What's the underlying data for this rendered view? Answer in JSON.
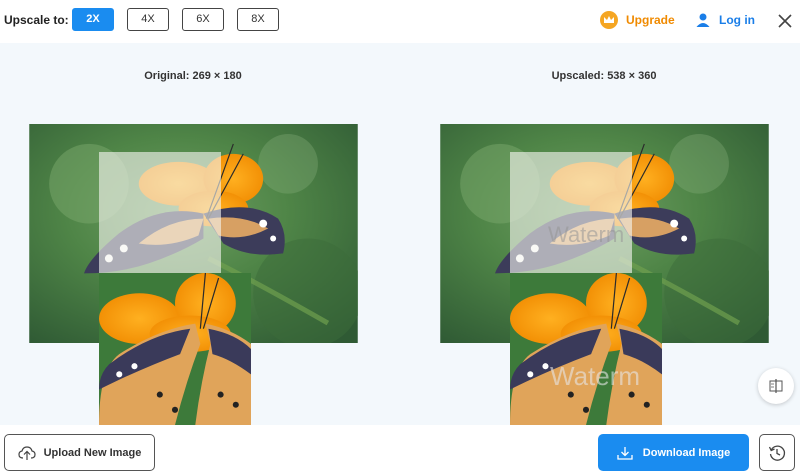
{
  "toolbar": {
    "upscale_label": "Upscale to:",
    "scales": [
      "2X",
      "4X",
      "6X",
      "8X"
    ],
    "active_scale": "2X",
    "upgrade_label": "Upgrade",
    "login_label": "Log in"
  },
  "preview": {
    "original_caption": "Original: 269 × 180",
    "upscaled_caption": "Upscaled: 538 × 360",
    "watermark_text": "Waterm"
  },
  "actions": {
    "upload_label": "Upload New Image",
    "download_label": "Download Image"
  },
  "colors": {
    "accent": "#1a8cf0",
    "upgrade": "#f08a00",
    "login": "#1a7ee8",
    "background": "#f3f8fc"
  },
  "icons": [
    "crown-icon",
    "user-icon",
    "close-icon",
    "upload-cloud-icon",
    "download-icon",
    "history-icon",
    "compare-icon"
  ]
}
